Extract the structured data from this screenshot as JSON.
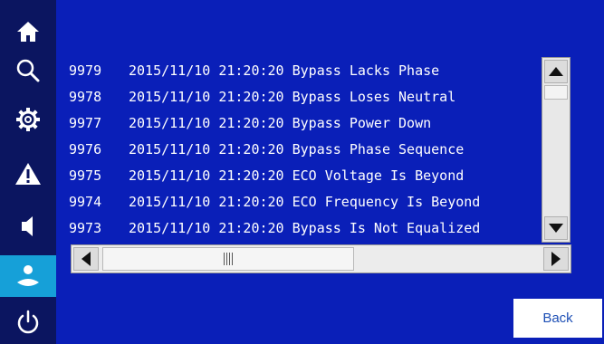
{
  "sidebar": {
    "items": [
      {
        "icon": "home-icon"
      },
      {
        "icon": "search-icon"
      },
      {
        "icon": "gear-icon"
      },
      {
        "icon": "alarm-warning-icon"
      },
      {
        "icon": "speaker-mute-icon"
      },
      {
        "icon": "user-icon"
      },
      {
        "icon": "power-icon"
      }
    ],
    "active_index": 5
  },
  "log": {
    "rows": [
      {
        "id": "9979",
        "timestamp": "2015/11/10 21:20:20",
        "message": "Bypass Lacks Phase"
      },
      {
        "id": "9978",
        "timestamp": "2015/11/10 21:20:20",
        "message": "Bypass Loses Neutral"
      },
      {
        "id": "9977",
        "timestamp": "2015/11/10 21:20:20",
        "message": "Bypass Power Down"
      },
      {
        "id": "9976",
        "timestamp": "2015/11/10 21:20:20",
        "message": "Bypass Phase Sequence"
      },
      {
        "id": "9975",
        "timestamp": "2015/11/10 21:20:20",
        "message": "ECO Voltage Is Beyond"
      },
      {
        "id": "9974",
        "timestamp": "2015/11/10 21:20:20",
        "message": "ECO Frequency Is Beyond"
      },
      {
        "id": "9973",
        "timestamp": "2015/11/10 21:20:20",
        "message": "Bypass Is Not Equalized"
      }
    ]
  },
  "buttons": {
    "back_label": "Back"
  },
  "colors": {
    "background": "#0a1fb8",
    "sidebar": "#0b1560",
    "active": "#16a0d8",
    "text": "#ffffff"
  }
}
